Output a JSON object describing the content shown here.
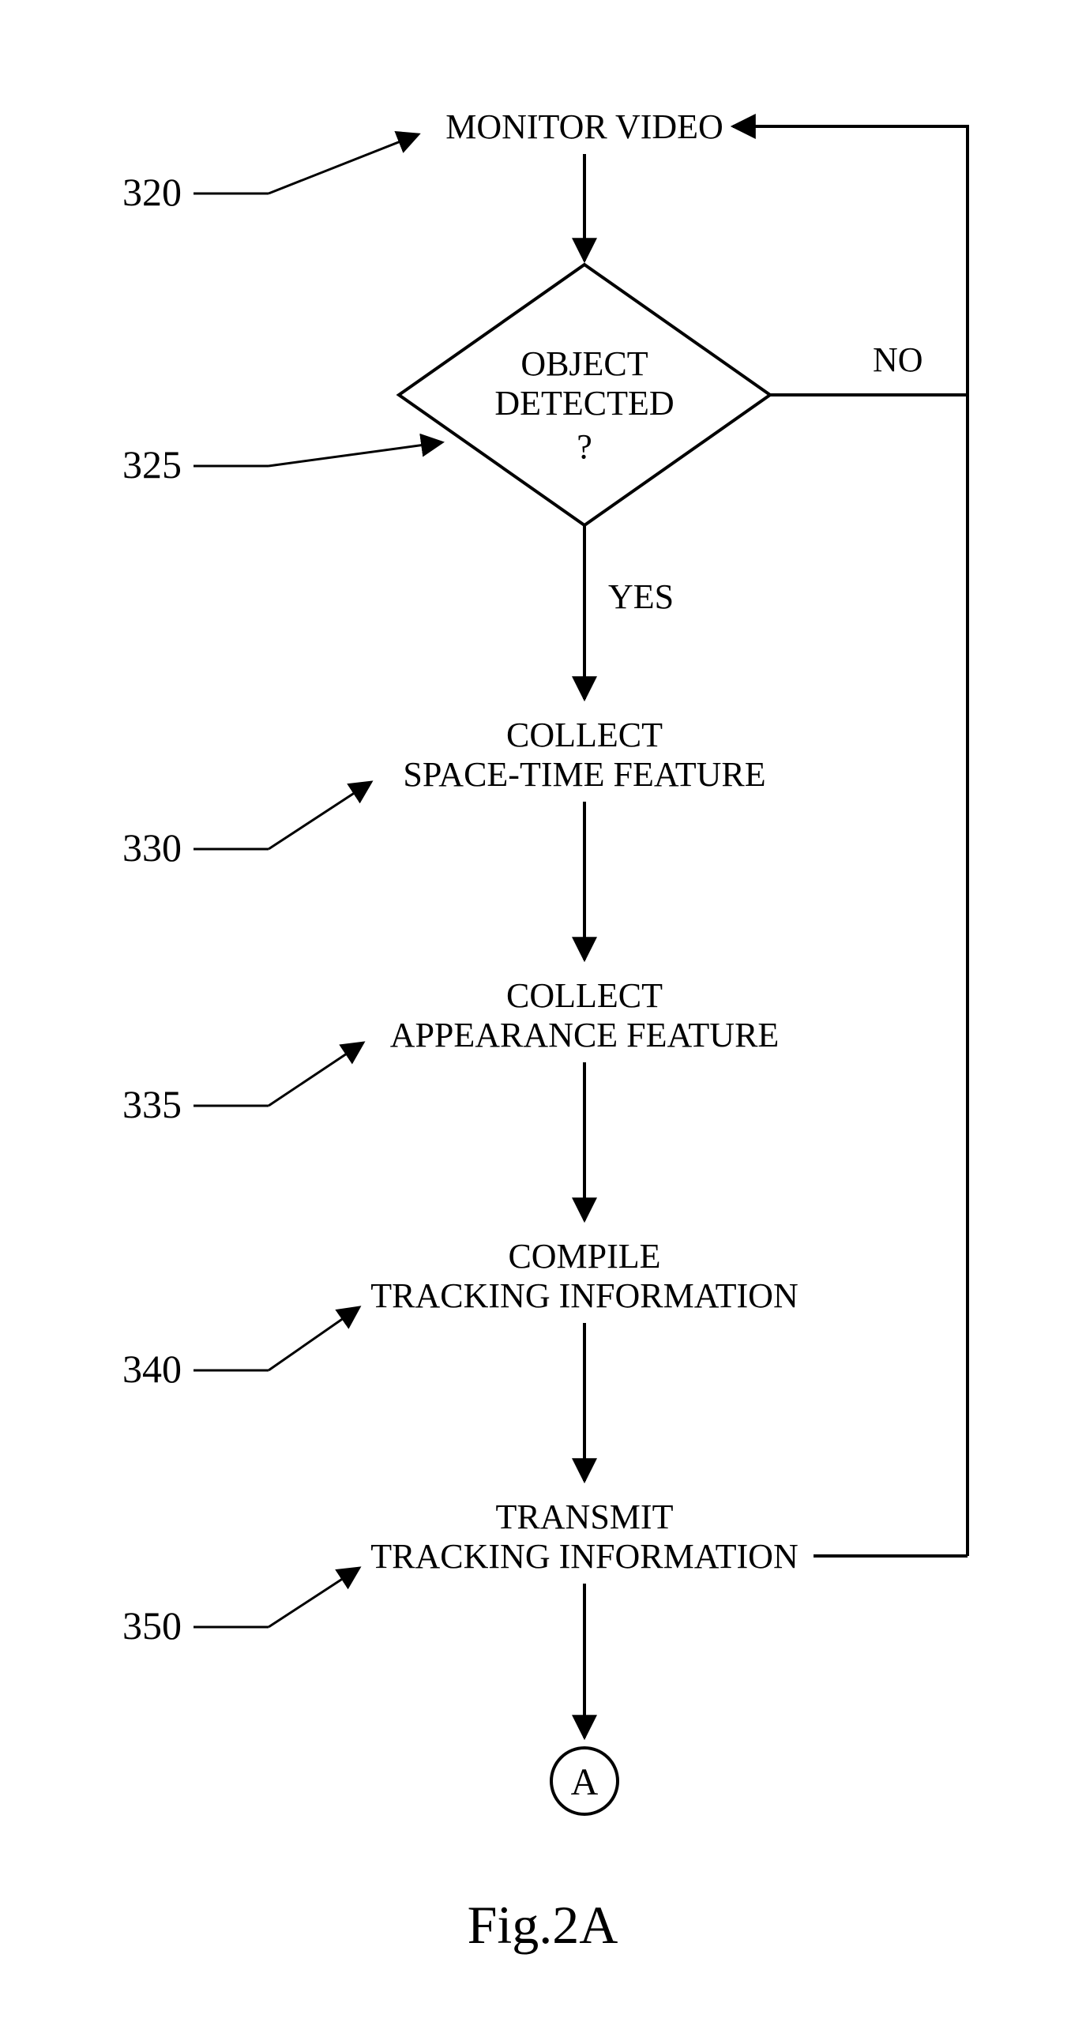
{
  "nodes": {
    "monitor": "MONITOR VIDEO",
    "decision": {
      "line1": "OBJECT",
      "line2": "DETECTED",
      "line3": "?"
    },
    "collect_st": {
      "line1": "COLLECT",
      "line2": "SPACE-TIME FEATURE"
    },
    "collect_ap": {
      "line1": "COLLECT",
      "line2": "APPEARANCE FEATURE"
    },
    "compile": {
      "line1": "COMPILE",
      "line2": "TRACKING INFORMATION"
    },
    "transmit": {
      "line1": "TRANSMIT",
      "line2": "TRACKING INFORMATION"
    },
    "connectorA": "A"
  },
  "labels": {
    "no": "NO",
    "yes": "YES"
  },
  "refs": {
    "r320": "320",
    "r325": "325",
    "r330": "330",
    "r335": "335",
    "r340": "340",
    "r350": "350"
  },
  "caption": "Fig.2A"
}
